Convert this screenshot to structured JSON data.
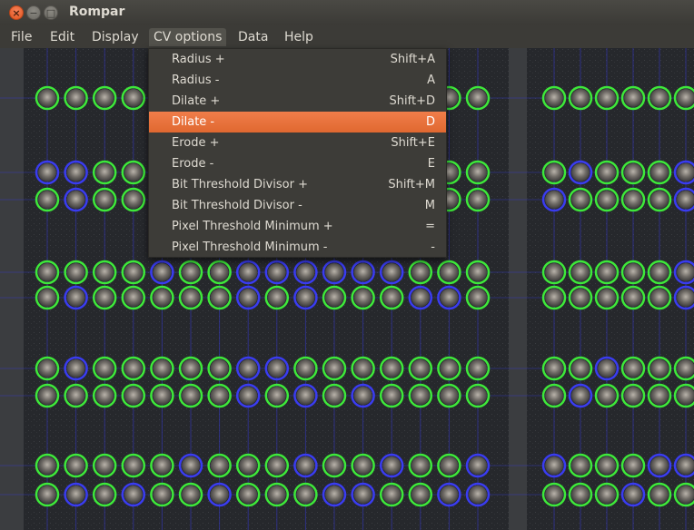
{
  "window": {
    "title": "Rompar",
    "close_glyph": "×",
    "min_glyph": "−",
    "max_glyph": "□"
  },
  "menubar": {
    "items": [
      {
        "label": "File"
      },
      {
        "label": "Edit"
      },
      {
        "label": "Display"
      },
      {
        "label": "CV options"
      },
      {
        "label": "Data"
      },
      {
        "label": "Help"
      }
    ]
  },
  "cv_menu": {
    "items": [
      {
        "label": "Radius +",
        "shortcut": "Shift+A"
      },
      {
        "label": "Radius -",
        "shortcut": "A"
      },
      {
        "label": "Dilate +",
        "shortcut": "Shift+D"
      },
      {
        "label": "Dilate -",
        "shortcut": "D",
        "highlighted": true
      },
      {
        "label": "Erode +",
        "shortcut": "Shift+E"
      },
      {
        "label": "Erode -",
        "shortcut": "E"
      },
      {
        "label": "Bit Threshold Divisor +",
        "shortcut": "Shift+M"
      },
      {
        "label": "Bit Threshold Divisor -",
        "shortcut": "M"
      },
      {
        "label": "Pixel Threshold Minimum +",
        "shortcut": "="
      },
      {
        "label": "Pixel Threshold Minimum -",
        "shortcut": "-"
      }
    ]
  },
  "colors": {
    "bit_set": "#3ee83a",
    "bit_clear": "#3a3cf0",
    "highlight": "#f07d4a"
  }
}
